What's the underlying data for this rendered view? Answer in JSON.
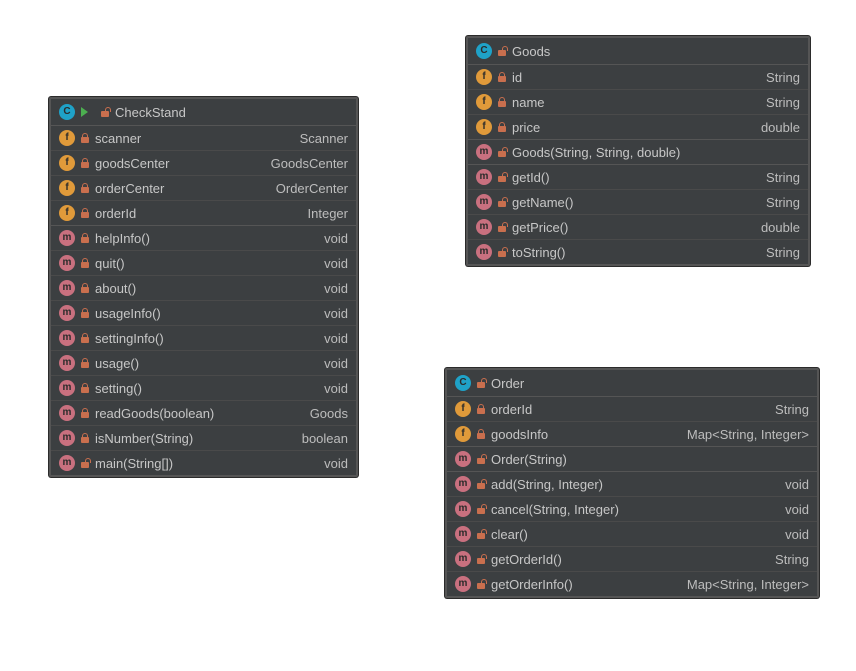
{
  "checkStand": {
    "title": "CheckStand",
    "fields": [
      {
        "name": "scanner",
        "type": "Scanner",
        "vis": "private"
      },
      {
        "name": "goodsCenter",
        "type": "GoodsCenter",
        "vis": "private"
      },
      {
        "name": "orderCenter",
        "type": "OrderCenter",
        "vis": "private"
      },
      {
        "name": "orderId",
        "type": "Integer",
        "vis": "private"
      }
    ],
    "methods": [
      {
        "sig": "helpInfo()",
        "ret": "void",
        "vis": "private"
      },
      {
        "sig": "quit()",
        "ret": "void",
        "vis": "private"
      },
      {
        "sig": "about()",
        "ret": "void",
        "vis": "private"
      },
      {
        "sig": "usageInfo()",
        "ret": "void",
        "vis": "private"
      },
      {
        "sig": "settingInfo()",
        "ret": "void",
        "vis": "private"
      },
      {
        "sig": "usage()",
        "ret": "void",
        "vis": "private"
      },
      {
        "sig": "setting()",
        "ret": "void",
        "vis": "private"
      },
      {
        "sig": "readGoods(boolean)",
        "ret": "Goods",
        "vis": "private"
      },
      {
        "sig": "isNumber(String)",
        "ret": "boolean",
        "vis": "private"
      },
      {
        "sig": "main(String[])",
        "ret": "void",
        "vis": "public"
      }
    ]
  },
  "goods": {
    "title": "Goods",
    "fields": [
      {
        "name": "id",
        "type": "String",
        "vis": "private"
      },
      {
        "name": "name",
        "type": "String",
        "vis": "private"
      },
      {
        "name": "price",
        "type": "double",
        "vis": "private"
      }
    ],
    "ctors": [
      {
        "sig": "Goods(String, String, double)",
        "vis": "public"
      }
    ],
    "methods": [
      {
        "sig": "getId()",
        "ret": "String",
        "vis": "public"
      },
      {
        "sig": "getName()",
        "ret": "String",
        "vis": "public"
      },
      {
        "sig": "getPrice()",
        "ret": "double",
        "vis": "public"
      },
      {
        "sig": "toString()",
        "ret": "String",
        "vis": "public"
      }
    ]
  },
  "order": {
    "title": "Order",
    "fields": [
      {
        "name": "orderId",
        "type": "String",
        "vis": "private"
      },
      {
        "name": "goodsInfo",
        "type": "Map<String, Integer>",
        "vis": "private"
      }
    ],
    "ctors": [
      {
        "sig": "Order(String)",
        "vis": "public"
      }
    ],
    "methods": [
      {
        "sig": "add(String, Integer)",
        "ret": "void",
        "vis": "public"
      },
      {
        "sig": "cancel(String, Integer)",
        "ret": "void",
        "vis": "public"
      },
      {
        "sig": "clear()",
        "ret": "void",
        "vis": "public"
      },
      {
        "sig": "getOrderId()",
        "ret": "String",
        "vis": "public"
      },
      {
        "sig": "getOrderInfo()",
        "ret": "Map<String, Integer>",
        "vis": "public"
      }
    ]
  }
}
